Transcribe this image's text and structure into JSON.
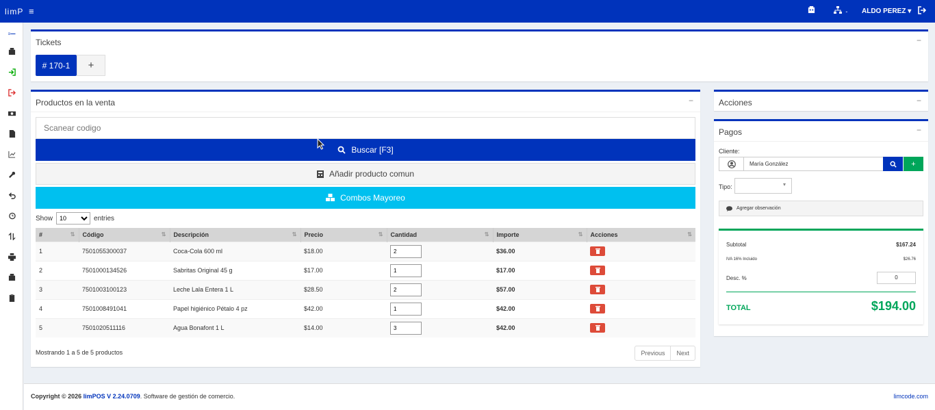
{
  "app": {
    "brand": "limP",
    "user": "ALDO PEREZ",
    "store_sep": "-"
  },
  "colors": {
    "primary": "#0033bb",
    "danger": "#dd4b39",
    "success": "#00a65a",
    "info": "#00c0ef"
  },
  "tickets": {
    "title": "Tickets",
    "active": "# 170-1"
  },
  "products": {
    "title": "Productos en la venta",
    "scan_placeholder": "Scanear codigo",
    "buscar": "Buscar [F3]",
    "anadir": "Añadir producto comun",
    "combos": "Combos Mayoreo",
    "show": "Show",
    "entries_count": "10",
    "entries": "entries",
    "columns": [
      "#",
      "Código",
      "Descripción",
      "Precio",
      "Cantidad",
      "Importe",
      "Acciones"
    ],
    "rows": [
      {
        "n": "1",
        "code": "7501055300037",
        "desc": "Coca-Cola 600 ml",
        "price": "$18.00",
        "qty": "2",
        "imp": "$36.00"
      },
      {
        "n": "2",
        "code": "7501000134526",
        "desc": "Sabritas Original 45 g",
        "price": "$17.00",
        "qty": "1",
        "imp": "$17.00"
      },
      {
        "n": "3",
        "code": "7501003100123",
        "desc": "Leche Lala Entera 1 L",
        "price": "$28.50",
        "qty": "2",
        "imp": "$57.00"
      },
      {
        "n": "4",
        "code": "7501008491041",
        "desc": "Papel higiénico Pétalo 4 pz",
        "price": "$42.00",
        "qty": "1",
        "imp": "$42.00"
      },
      {
        "n": "5",
        "code": "7501020511116",
        "desc": "Agua Bonafont 1 L",
        "price": "$14.00",
        "qty": "3",
        "imp": "$42.00"
      }
    ],
    "info": "Mostrando 1 a 5 de 5 productos",
    "prev": "Previous",
    "next": "Next"
  },
  "acciones": {
    "title": "Acciones"
  },
  "pagos": {
    "title": "Pagos",
    "cliente_label": "Cliente:",
    "cliente": "María González",
    "tipo_label": "Tipo:",
    "obs": "Agregar observación",
    "subtotal_label": "Subtotal",
    "subtotal": "$167.24",
    "iva_label": "IVA 16% Incluido",
    "iva": "$26.76",
    "desc_label": "Desc. %",
    "desc": "0",
    "total_label": "TOTAL",
    "total": "$194.00"
  },
  "footer": {
    "copy": "Copyright © 2026 ",
    "ver": "limPOS V 2.24.0709",
    "desc": ". Software de gestión de comercio.",
    "link": "limcode.com"
  }
}
